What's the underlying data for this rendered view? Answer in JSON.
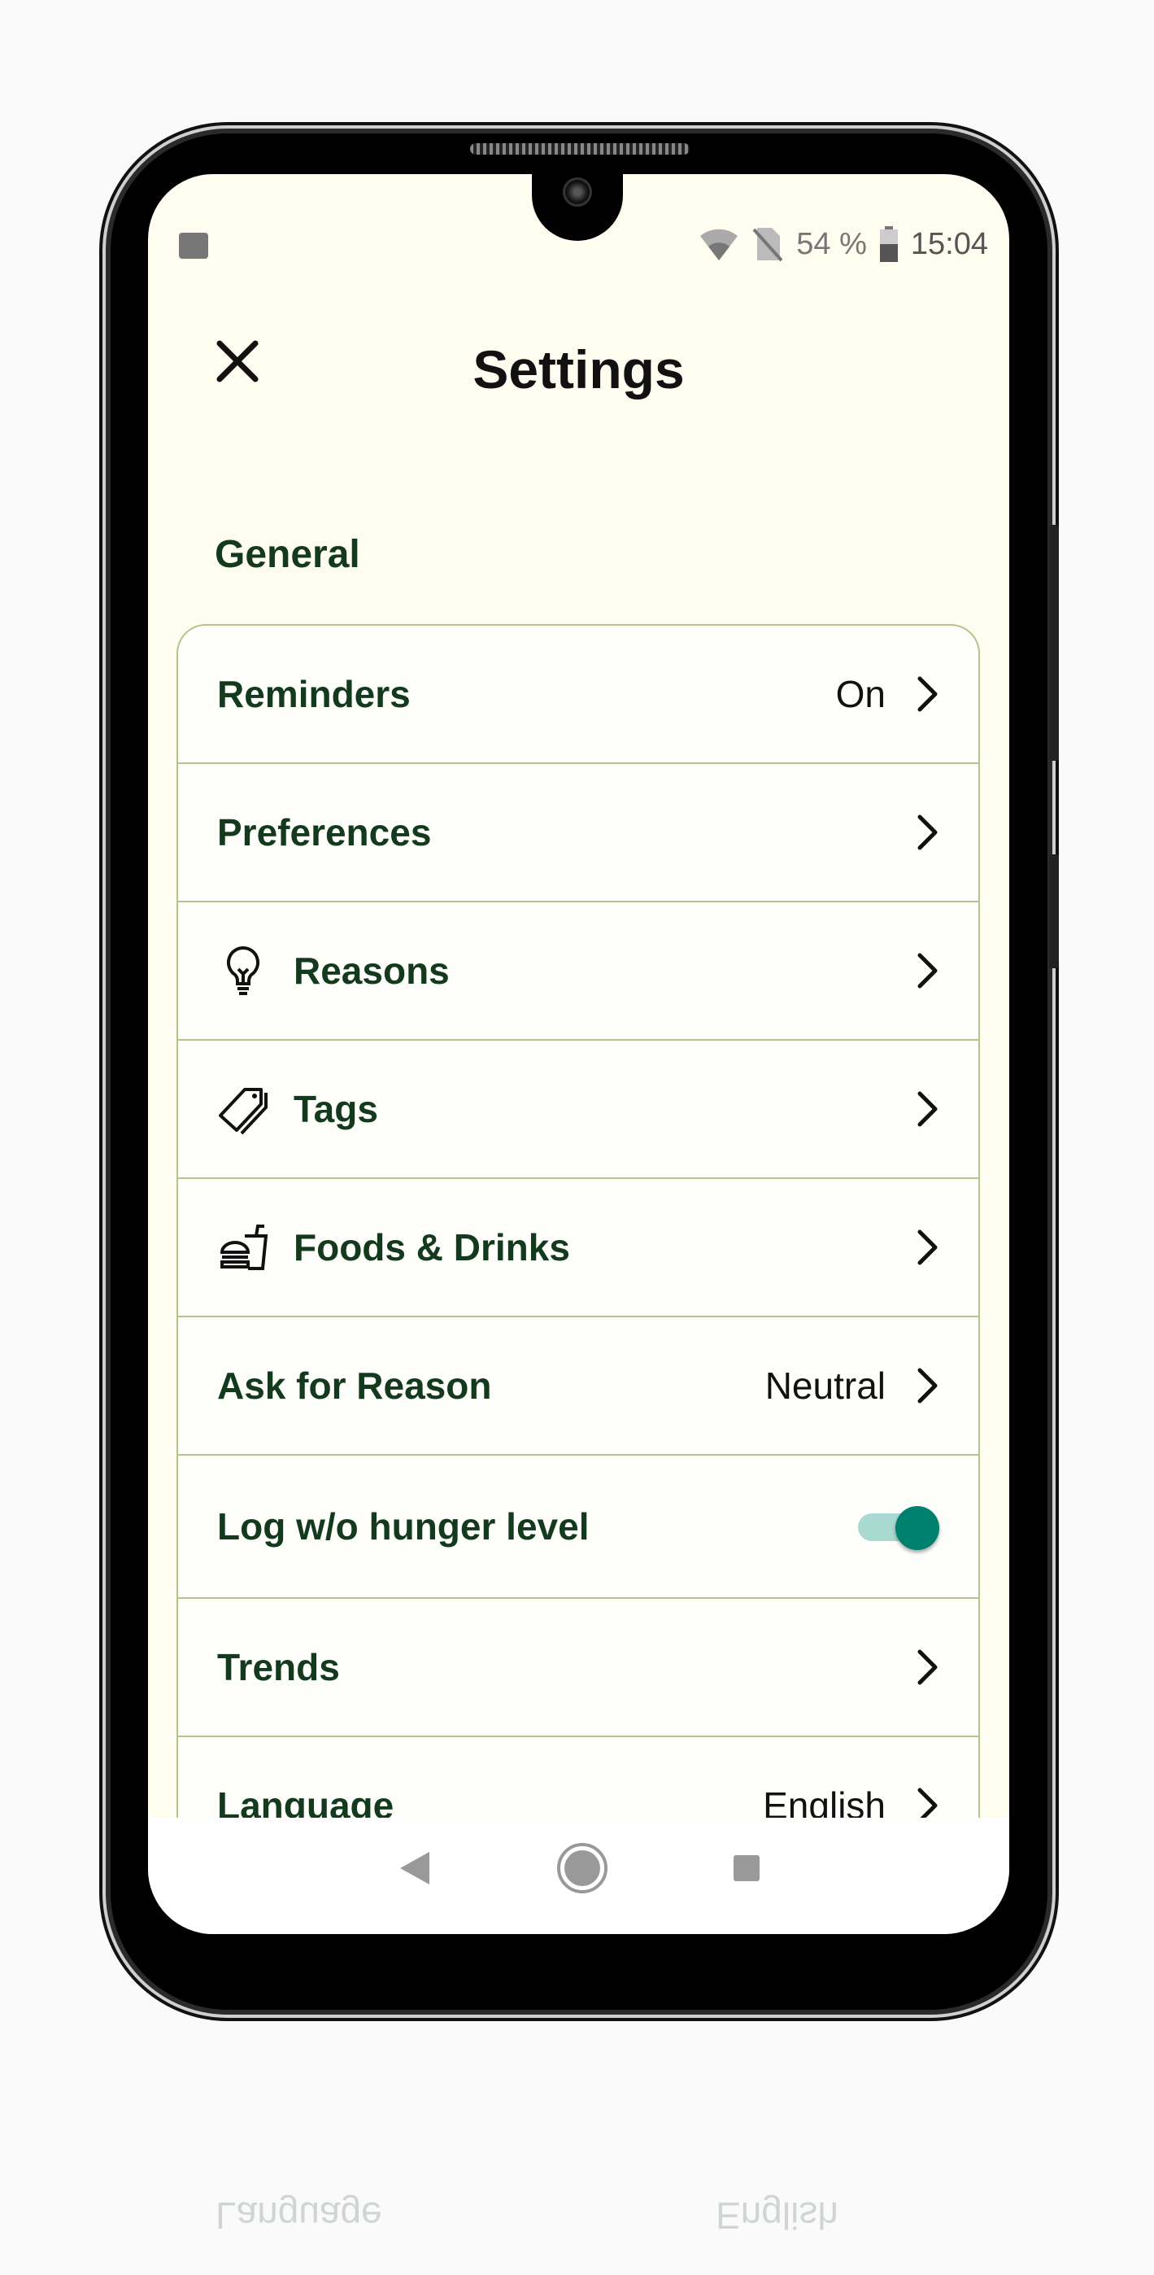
{
  "status_bar": {
    "battery": "54 %",
    "time": "15:04",
    "icons": [
      "image-icon",
      "wifi-icon",
      "no-sim-icon",
      "battery-icon"
    ]
  },
  "header": {
    "title": "Settings",
    "close_icon": "close-icon"
  },
  "section": {
    "title": "General"
  },
  "rows": [
    {
      "label": "Reminders",
      "value": "On"
    },
    {
      "label": "Preferences",
      "value": ""
    },
    {
      "label": "Reasons",
      "value": "",
      "icon": "lightbulb-icon"
    },
    {
      "label": "Tags",
      "value": "",
      "icon": "tag-icon"
    },
    {
      "label": "Foods & Drinks",
      "value": "",
      "icon": "food-drink-icon"
    },
    {
      "label": "Ask for Reason",
      "value": "Neutral"
    },
    {
      "label": "Log w/o hunger level",
      "toggle": true
    },
    {
      "label": "Trends",
      "value": ""
    },
    {
      "label": "Language",
      "value": "English"
    }
  ],
  "colors": {
    "background": "#fefdf0",
    "text": "#143a1e",
    "divider": "#b4c48a",
    "toggle": "#00806f"
  }
}
